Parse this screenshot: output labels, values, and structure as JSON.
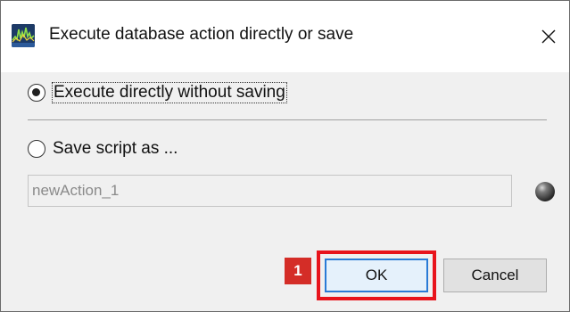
{
  "window": {
    "title": "Execute database action directly or save",
    "close_glyph": "✕"
  },
  "options": {
    "execute_directly_label": "Execute directly without saving",
    "execute_directly_selected": true,
    "save_script_label": "Save script as ...",
    "save_script_selected": false
  },
  "script_name": {
    "value": "newAction_1"
  },
  "buttons": {
    "ok_label": "OK",
    "cancel_label": "Cancel"
  },
  "annotation": {
    "step_number": "1",
    "highlight_color": "#e8141c"
  },
  "icons": {
    "app": "app-logo-icon",
    "close": "close-icon",
    "status": "status-indicator-icon"
  }
}
